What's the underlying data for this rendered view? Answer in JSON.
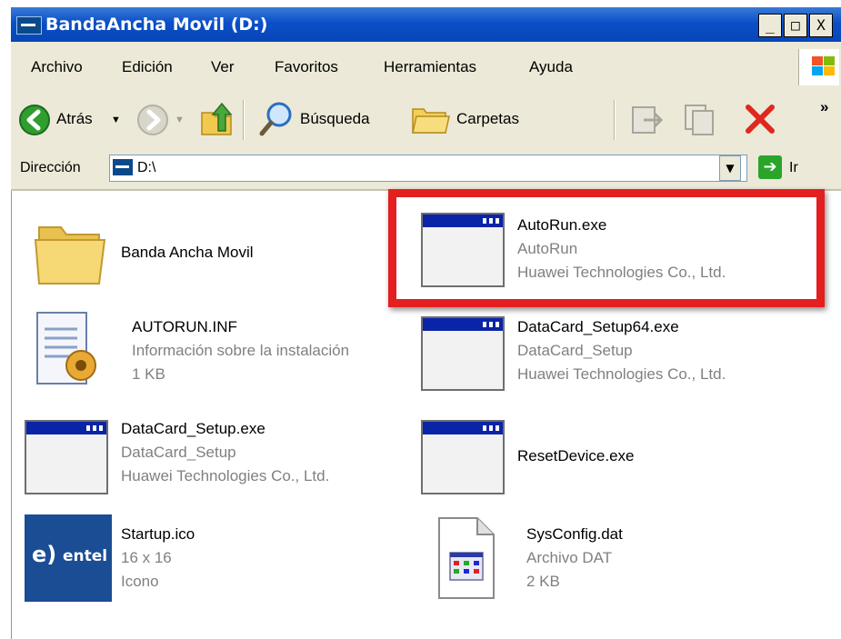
{
  "window": {
    "title": "BandaAncha Movil (D:)",
    "controls": {
      "minimize": "_",
      "maximize": "□",
      "close": "X"
    }
  },
  "menu": {
    "items": [
      "Archivo",
      "Edición",
      "Ver",
      "Favoritos",
      "Herramientas",
      "Ayuda"
    ]
  },
  "toolbar": {
    "back_label": "Atrás",
    "search_label": "Búsqueda",
    "folders_label": "Carpetas",
    "more": "»"
  },
  "address": {
    "label": "Dirección",
    "value": "D:\\",
    "go_label": "Ir"
  },
  "files": [
    {
      "name": "Banda Ancha Movil",
      "type": "folder"
    },
    {
      "name": "AutoRun.exe",
      "line2": "AutoRun",
      "line3": "Huawei Technologies Co., Ltd.",
      "type": "exe",
      "highlighted": true
    },
    {
      "name": "AUTORUN.INF",
      "line2": "Información sobre la instalación",
      "line3": "1 KB",
      "type": "inf"
    },
    {
      "name": "DataCard_Setup64.exe",
      "line2": "DataCard_Setup",
      "line3": "Huawei Technologies Co., Ltd.",
      "type": "exe"
    },
    {
      "name": "DataCard_Setup.exe",
      "line2": "DataCard_Setup",
      "line3": "Huawei Technologies Co., Ltd.",
      "type": "exe"
    },
    {
      "name": "ResetDevice.exe",
      "type": "exe"
    },
    {
      "name": "Startup.ico",
      "line2": "16 x 16",
      "line3": "Icono",
      "type": "ico",
      "logo_text": "entel",
      "logo_mark": "e)"
    },
    {
      "name": "SysConfig.dat",
      "line2": "Archivo DAT",
      "line3": "2 KB",
      "type": "dat"
    }
  ],
  "colors": {
    "titlebar": "#0a4fc7",
    "highlight": "#e41f1f",
    "entel_blue": "#1a4d94"
  }
}
